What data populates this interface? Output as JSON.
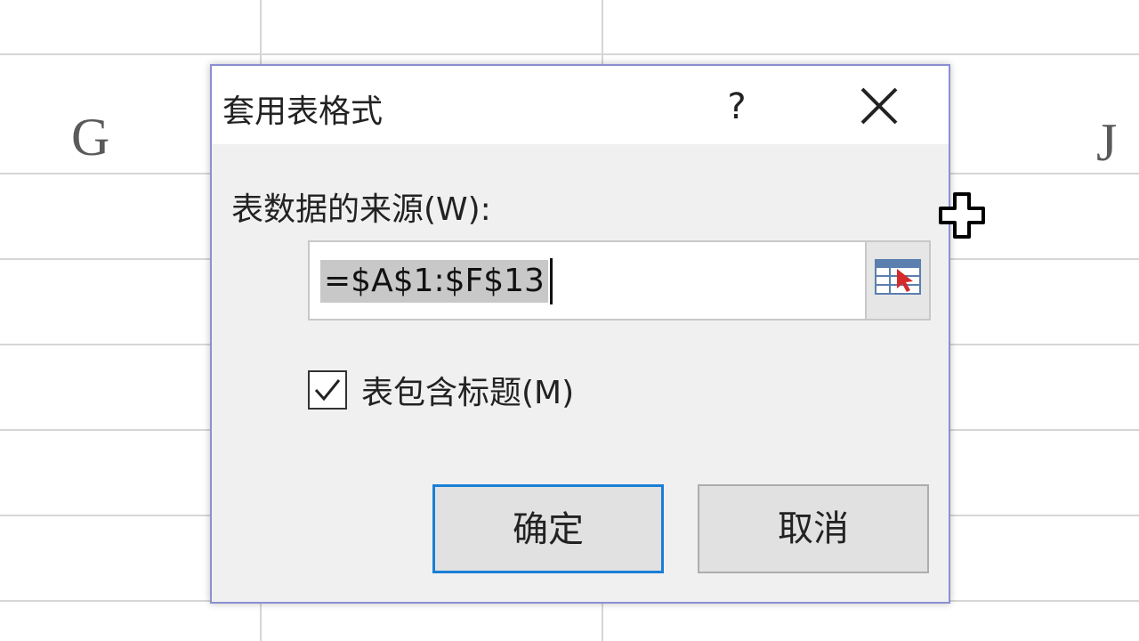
{
  "sheet": {
    "col_left": "G",
    "col_right": "J"
  },
  "dialog": {
    "title": "套用表格式",
    "help_label": "?",
    "source_label": "表数据的来源(W):",
    "range_value": "=$A$1:$F$13",
    "header_checkbox_label": "表包含标题(M)",
    "header_checked": true,
    "ok_label": "确定",
    "cancel_label": "取消"
  },
  "icons": {
    "close": "close-icon",
    "collapse": "range-select-icon",
    "cursor": "move-cursor-icon",
    "check": "checkmark-icon"
  },
  "colors": {
    "dialog_border": "#8c8fd1",
    "ok_border": "#1a7fd6",
    "selection": "#c8c8c8"
  }
}
